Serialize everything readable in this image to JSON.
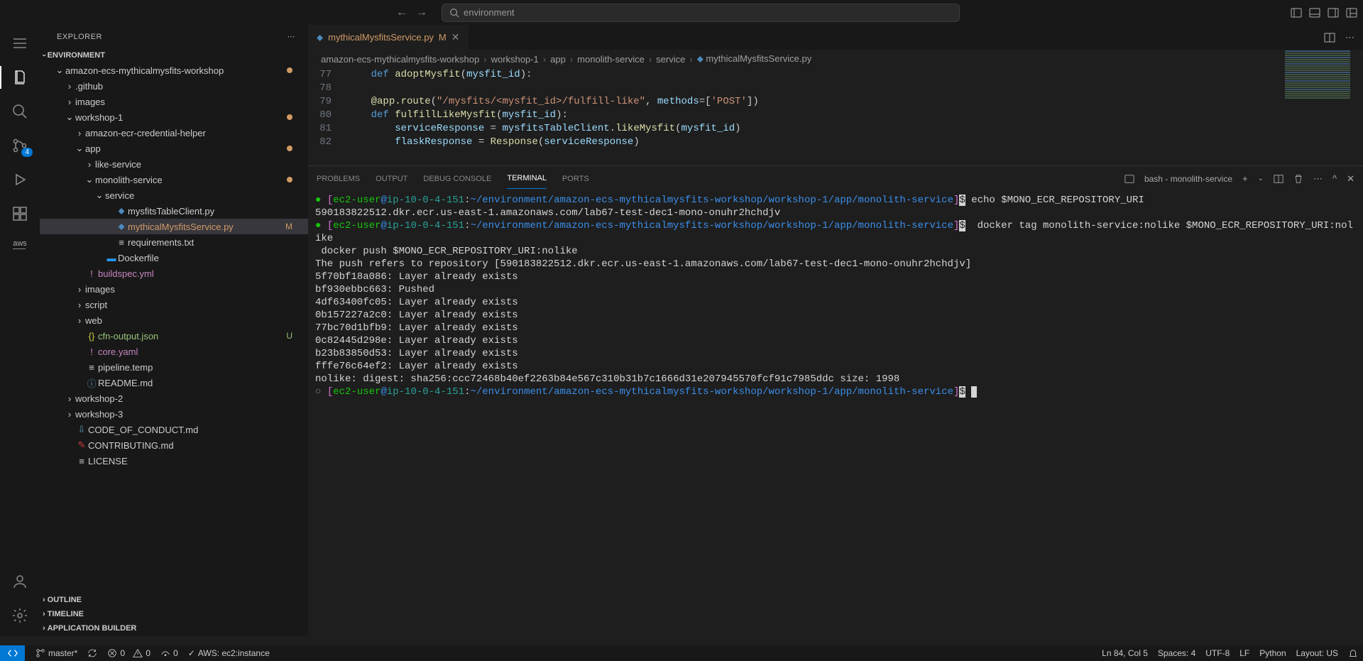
{
  "topbar": {
    "search_text": "environment"
  },
  "activity": {
    "scm_badge": "4"
  },
  "sidebar": {
    "title": "EXPLORER",
    "sections": {
      "env": "ENVIRONMENT",
      "outline": "OUTLINE",
      "timeline": "TIMELINE",
      "appbuilder": "APPLICATION BUILDER"
    },
    "tree": [
      {
        "d": 1,
        "t": "folder",
        "open": true,
        "name": "amazon-ecs-mythicalmysfits-workshop",
        "dot": "#d19a66"
      },
      {
        "d": 2,
        "t": "folder",
        "open": false,
        "name": ".github"
      },
      {
        "d": 2,
        "t": "folder",
        "open": false,
        "name": "images"
      },
      {
        "d": 2,
        "t": "folder",
        "open": true,
        "name": "workshop-1",
        "dot": "#d19a66"
      },
      {
        "d": 3,
        "t": "folder",
        "open": false,
        "name": "amazon-ecr-credential-helper"
      },
      {
        "d": 3,
        "t": "folder",
        "open": true,
        "name": "app",
        "dot": "#d19a66"
      },
      {
        "d": 4,
        "t": "folder",
        "open": false,
        "name": "like-service"
      },
      {
        "d": 4,
        "t": "folder",
        "open": true,
        "name": "monolith-service",
        "dot": "#d19a66"
      },
      {
        "d": 5,
        "t": "folder",
        "open": true,
        "name": "service"
      },
      {
        "d": 6,
        "t": "file",
        "name": "mysfitsTableClient.py",
        "icon": "py"
      },
      {
        "d": 6,
        "t": "file",
        "name": "mythicalMysfitsService.py",
        "icon": "py",
        "status": "M",
        "cls": "f-mod",
        "selected": true
      },
      {
        "d": 6,
        "t": "file",
        "name": "requirements.txt",
        "icon": "txt"
      },
      {
        "d": 5,
        "t": "file",
        "name": "Dockerfile",
        "icon": "docker",
        "cls": "f-normal",
        "iconColor": "#2496ed"
      },
      {
        "d": 3,
        "t": "file",
        "name": "buildspec.yml",
        "icon": "yml",
        "cls": "f-yaml",
        "iconColor": "#c586c0"
      },
      {
        "d": 3,
        "t": "folder",
        "open": false,
        "name": "images"
      },
      {
        "d": 3,
        "t": "folder",
        "open": false,
        "name": "script"
      },
      {
        "d": 3,
        "t": "folder",
        "open": false,
        "name": "web"
      },
      {
        "d": 3,
        "t": "file",
        "name": "cfn-output.json",
        "icon": "json",
        "status": "U",
        "cls": "f-new",
        "iconColor": "#cbcb41"
      },
      {
        "d": 3,
        "t": "file",
        "name": "core.yaml",
        "icon": "yml",
        "cls": "f-yaml",
        "iconColor": "#c586c0"
      },
      {
        "d": 3,
        "t": "file",
        "name": "pipeline.temp",
        "icon": "txt"
      },
      {
        "d": 3,
        "t": "file",
        "name": "README.md",
        "icon": "info",
        "iconColor": "#519aba"
      },
      {
        "d": 2,
        "t": "folder",
        "open": false,
        "name": "workshop-2"
      },
      {
        "d": 2,
        "t": "folder",
        "open": false,
        "name": "workshop-3"
      },
      {
        "d": 2,
        "t": "file",
        "name": "CODE_OF_CONDUCT.md",
        "icon": "md",
        "iconColor": "#519aba"
      },
      {
        "d": 2,
        "t": "file",
        "name": "CONTRIBUTING.md",
        "icon": "md2",
        "iconColor": "#cc3e44"
      },
      {
        "d": 2,
        "t": "file",
        "name": "LICENSE",
        "icon": "txt"
      }
    ]
  },
  "editor": {
    "tab": {
      "name": "mythicalMysfitsService.py",
      "status": "M"
    },
    "breadcrumb": [
      "amazon-ecs-mythicalmysfits-workshop",
      "workshop-1",
      "app",
      "monolith-service",
      "service",
      "mythicalMysfitsService.py"
    ],
    "lines": [
      {
        "n": 77,
        "html": "    <span class='k-def'>def</span> <span class='k-fn'>adoptMysfit</span>(<span class='k-param'>mysfit_id</span>):"
      },
      {
        "n": 78,
        "html": ""
      },
      {
        "n": 79,
        "html": "    <span class='k-dec'>@app.route</span>(<span class='k-str'>\"/mysfits/&lt;mysfit_id&gt;/fulfill-like\"</span>, <span class='k-param'>methods</span>=[<span class='k-str'>'POST'</span>])"
      },
      {
        "n": 80,
        "html": "    <span class='k-def'>def</span> <span class='k-fn'>fulfillLikeMysfit</span>(<span class='k-param'>mysfit_id</span>):"
      },
      {
        "n": 81,
        "html": "        <span class='k-param'>serviceResponse</span> = <span class='k-param'>mysfitsTableClient</span>.<span class='k-fn'>likeMysfit</span>(<span class='k-param'>mysfit_id</span>)"
      },
      {
        "n": 82,
        "html": "        <span class='k-param'>flaskResponse</span> = <span class='k-fn'>Response</span>(<span class='k-param'>serviceResponse</span>)"
      }
    ]
  },
  "panel": {
    "tabs": {
      "problems": "PROBLEMS",
      "output": "OUTPUT",
      "debug": "DEBUG CONSOLE",
      "terminal": "TERMINAL",
      "ports": "PORTS"
    },
    "term_label": "bash - monolith-service",
    "prompt": {
      "user": "ec2-user",
      "at": "@",
      "host": "ip-10-0-4-151",
      "path": "~/environment/amazon-ecs-mythicalmysfits-workshop/workshop-1/app/monolith-service"
    },
    "lines": [
      {
        "type": "prompt",
        "bullet": "●",
        "cmd": "echo $MONO_ECR_REPOSITORY_URI"
      },
      {
        "type": "out",
        "text": "590183822512.dkr.ecr.us-east-1.amazonaws.com/lab67-test-dec1-mono-onuhr2hchdjv"
      },
      {
        "type": "prompt",
        "bullet": "●",
        "cmd": " docker tag monolith-service:nolike $MONO_ECR_REPOSITORY_URI:nolike"
      },
      {
        "type": "out",
        "text": " docker push $MONO_ECR_REPOSITORY_URI:nolike"
      },
      {
        "type": "out",
        "text": "The push refers to repository [590183822512.dkr.ecr.us-east-1.amazonaws.com/lab67-test-dec1-mono-onuhr2hchdjv]"
      },
      {
        "type": "out",
        "text": "5f70bf18a086: Layer already exists"
      },
      {
        "type": "out",
        "text": "bf930ebbc663: Pushed"
      },
      {
        "type": "out",
        "text": "4df63400fc05: Layer already exists"
      },
      {
        "type": "out",
        "text": "0b157227a2c0: Layer already exists"
      },
      {
        "type": "out",
        "text": "77bc70d1bfb9: Layer already exists"
      },
      {
        "type": "out",
        "text": "0c82445d298e: Layer already exists"
      },
      {
        "type": "out",
        "text": "b23b83850d53: Layer already exists"
      },
      {
        "type": "out",
        "text": "fffe76c64ef2: Layer already exists"
      },
      {
        "type": "out",
        "text": "nolike: digest: sha256:ccc72468b40ef2263b84e567c310b31b7c1666d31e207945570fcf91c7985ddc size: 1998"
      },
      {
        "type": "prompt",
        "bullet": "○",
        "cmd": "",
        "cursor": true
      }
    ]
  },
  "status": {
    "branch": "master*",
    "sync": "",
    "errors": "0",
    "warnings": "0",
    "ports": "0",
    "aws": "AWS: ec2:instance",
    "ln": "Ln 84, Col 5",
    "spaces": "Spaces: 4",
    "enc": "UTF-8",
    "eol": "LF",
    "lang": "Python",
    "layout": "Layout: US"
  }
}
